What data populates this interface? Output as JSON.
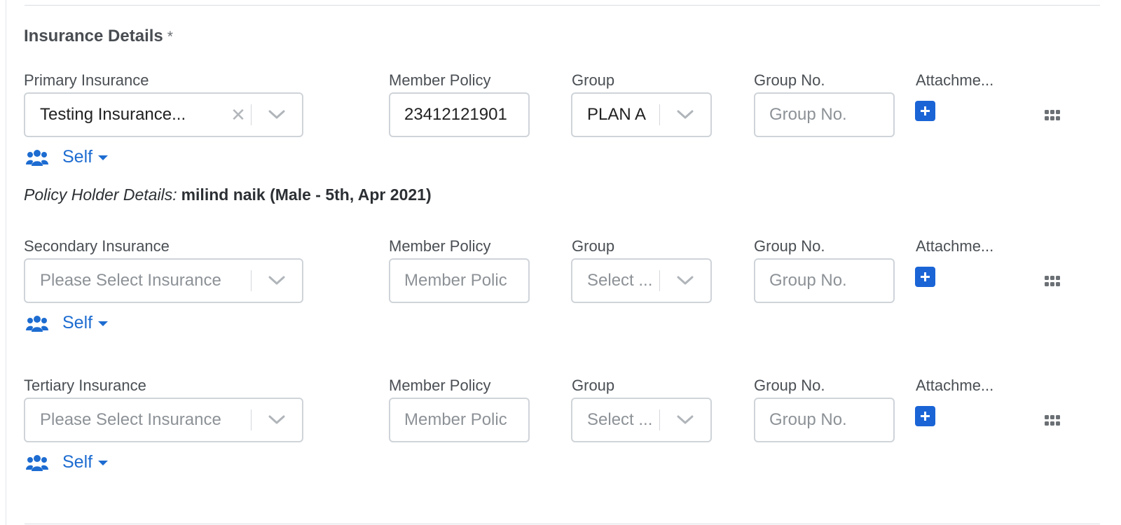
{
  "section": {
    "title": "Insurance Details",
    "required_marker": "*"
  },
  "rows": [
    {
      "insurance_label": "Primary Insurance",
      "insurance_value": "Testing Insurance...",
      "member_policy_label": "Member Policy",
      "member_policy_value": "23412121901",
      "group_label": "Group",
      "group_value": "PLAN A",
      "group_no_label": "Group No.",
      "group_no_placeholder": "Group No.",
      "attachment_label": "Attachme...",
      "relation": "Self"
    },
    {
      "insurance_label": "Secondary Insurance",
      "insurance_placeholder": "Please Select Insurance",
      "member_policy_label": "Member Policy",
      "member_policy_placeholder": "Member Polic",
      "group_label": "Group",
      "group_placeholder": "Select ...",
      "group_no_label": "Group No.",
      "group_no_placeholder": "Group No.",
      "attachment_label": "Attachme...",
      "relation": "Self"
    },
    {
      "insurance_label": "Tertiary Insurance",
      "insurance_placeholder": "Please Select Insurance",
      "member_policy_label": "Member Policy",
      "member_policy_placeholder": "Member Polic",
      "group_label": "Group",
      "group_placeholder": "Select ...",
      "group_no_label": "Group No.",
      "group_no_placeholder": "Group No.",
      "attachment_label": "Attachme...",
      "relation": "Self"
    }
  ],
  "policy_holder": {
    "label": "Policy Holder Details:",
    "value": "milind naik (Male - 5th, Apr 2021)"
  },
  "icons": {
    "clear": "clear-x-icon",
    "dropdown": "chevron-down-icon",
    "add": "plus-icon",
    "drag": "grip-dots-icon",
    "relation": "users-icon"
  },
  "colors": {
    "accent": "#1d6cd1",
    "add_button": "#1a64d6",
    "border": "#cfd4d9"
  }
}
